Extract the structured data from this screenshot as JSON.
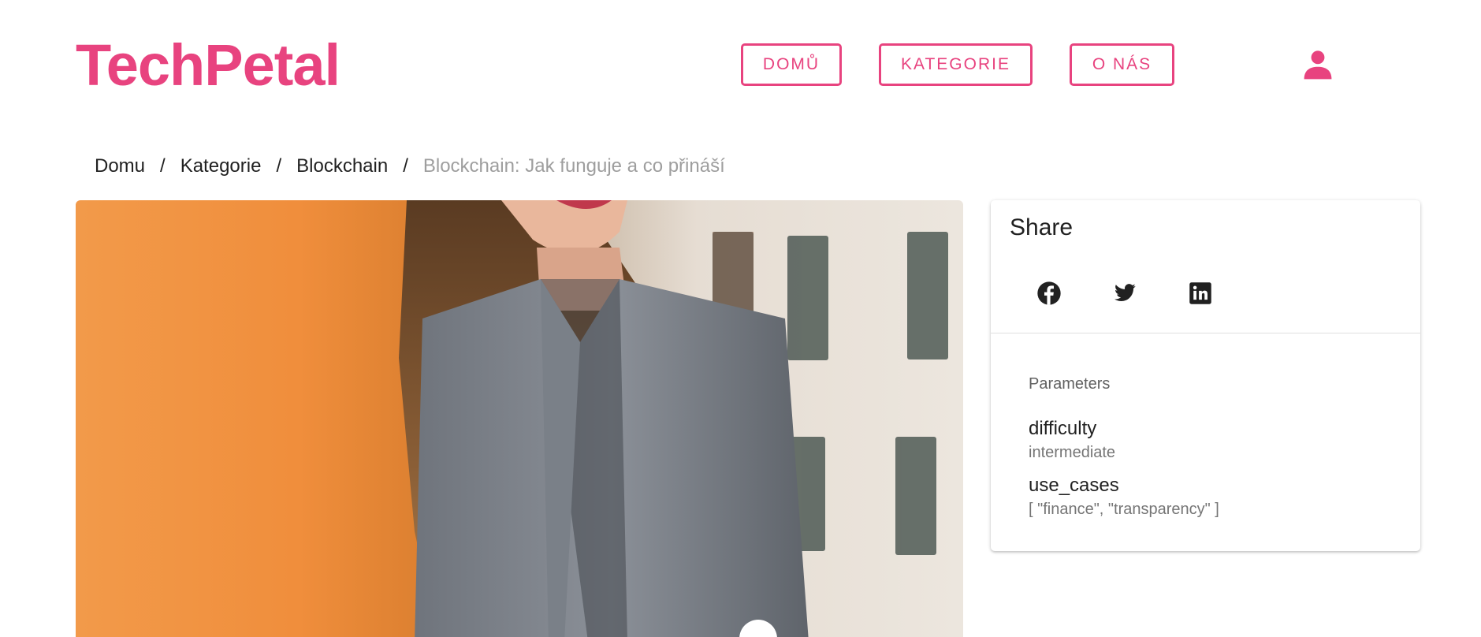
{
  "brand": {
    "logo": "TechPetal",
    "accent": "#e8437f"
  },
  "nav": {
    "items": [
      {
        "label": "DOMŮ"
      },
      {
        "label": "KATEGORIE"
      },
      {
        "label": "O NÁS"
      }
    ],
    "user_icon": "account-icon"
  },
  "breadcrumb": {
    "items": [
      "Domu",
      "Kategorie",
      "Blockchain"
    ],
    "separator": "/",
    "current": "Blockchain: Jak funguje a co přináší"
  },
  "hero": {
    "image": "photo of smiling woman with long hair in grey blazer by window"
  },
  "share": {
    "title": "Share",
    "icons": [
      "facebook-icon",
      "twitter-icon",
      "linkedin-icon"
    ]
  },
  "parameters": {
    "title": "Parameters",
    "items": [
      {
        "name": "difficulty",
        "value": "intermediate"
      },
      {
        "name": "use_cases",
        "value": "[ \"finance\", \"transparency\" ]"
      }
    ]
  }
}
